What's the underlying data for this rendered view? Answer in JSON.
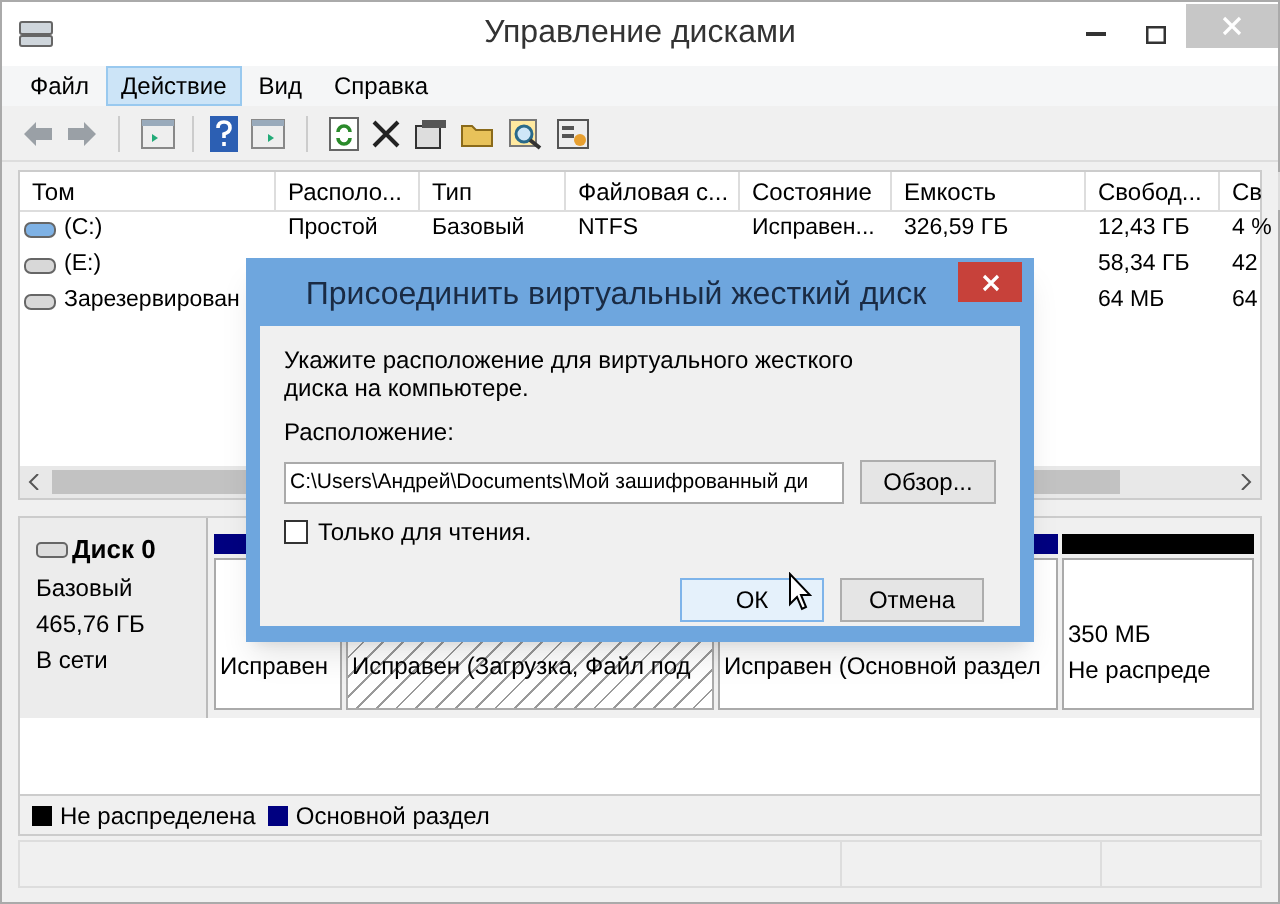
{
  "window": {
    "title": "Управление дисками"
  },
  "menu": [
    {
      "label": "Файл",
      "selected": false
    },
    {
      "label": "Действие",
      "selected": true
    },
    {
      "label": "Вид",
      "selected": false
    },
    {
      "label": "Справка",
      "selected": false
    }
  ],
  "volumes": {
    "columns": [
      "Том",
      "Располо...",
      "Тип",
      "Файловая с...",
      "Состояние",
      "Емкость",
      "Свобод...",
      "Св"
    ],
    "rows": [
      {
        "cells": [
          "(C:)",
          "Простой",
          "Базовый",
          "NTFS",
          "Исправен...",
          "326,59 ГБ",
          "12,43 ГБ",
          "4 %"
        ]
      },
      {
        "cells": [
          "(E:)",
          null,
          null,
          null,
          null,
          null,
          "58,34 ГБ",
          "42"
        ]
      },
      {
        "cells": [
          "Зарезервирован",
          null,
          null,
          null,
          null,
          null,
          "64 МБ",
          "64"
        ]
      }
    ]
  },
  "disk": {
    "name": "Диск 0",
    "type": "Базовый",
    "size": "465,76 ГБ",
    "status": "В сети",
    "partitions": [
      {
        "kind": "primary",
        "lines": [
          "Исправен"
        ]
      },
      {
        "kind": "primary_hatched",
        "lines": [
          "Исправен (Загрузка, Файл под"
        ]
      },
      {
        "kind": "primary",
        "lines": [
          "Исправен (Основной раздел"
        ]
      },
      {
        "kind": "unallocated",
        "lines": [
          "350 МБ",
          "Не распреде"
        ]
      }
    ]
  },
  "legend": [
    {
      "label": "Не распределена",
      "color": "#000000"
    },
    {
      "label": "Основной раздел",
      "color": "#000080"
    }
  ],
  "dialog": {
    "title": "Присоединить виртуальный жесткий диск",
    "prompt": "Укажите расположение для виртуального жесткого диска на компьютере.",
    "location_label": "Расположение:",
    "location_value": "C:\\Users\\Андрей\\Documents\\Мой зашифрованный ди",
    "browse": "Обзор...",
    "readonly": {
      "label": "Только для чтения.",
      "checked": false
    },
    "ok": "ОК",
    "cancel": "Отмена"
  }
}
